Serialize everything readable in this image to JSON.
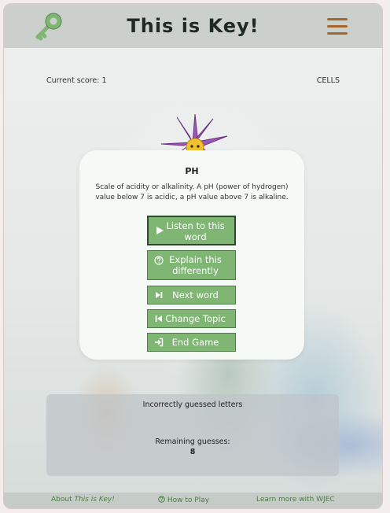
{
  "header": {
    "title": "This is Key!",
    "logo_icon": "key-icon",
    "menu_icon": "hamburger-menu-icon",
    "accent_color": "#a6672d"
  },
  "score": {
    "label": "Current score: 1",
    "topic": "CELLS"
  },
  "card": {
    "word": "PH",
    "definition": "Scale of acidity or alkalinity. A pH (power of hydrogen) value below 7 is acidic, a pH value above 7 is alkaline.",
    "buttons": {
      "listen": "Listen to this word",
      "explain": "Explain this differently",
      "next": "Next word",
      "change_topic": "Change Topic",
      "end_game": "End Game"
    },
    "button_color": "#7fb673"
  },
  "guesses": {
    "incorrect_label": "Incorrectly guessed letters",
    "remaining_label": "Remaining guesses:",
    "remaining_value": "8"
  },
  "footer": {
    "about_prefix": "About ",
    "about_title": "This is Key!",
    "how_to_play": "How to Play",
    "learn_more": "Learn more with WJEC"
  }
}
